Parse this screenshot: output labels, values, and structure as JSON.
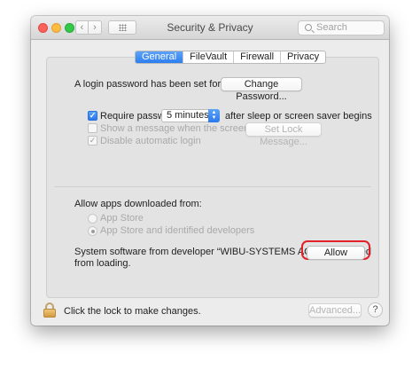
{
  "window": {
    "title": "Security & Privacy",
    "nav_back": "‹",
    "nav_forward": "›",
    "search_placeholder": "Search"
  },
  "tabs": [
    {
      "label": "General",
      "active": true
    },
    {
      "label": "FileVault",
      "active": false
    },
    {
      "label": "Firewall",
      "active": false
    },
    {
      "label": "Privacy",
      "active": false
    }
  ],
  "general": {
    "login_password_text": "A login password has been set for this user",
    "change_password_label": "Change Password...",
    "require_password_label": "Require password",
    "require_password_checked": true,
    "require_password_delay": "5 minutes",
    "require_password_suffix": "after sleep or screen saver begins",
    "show_message_label": "Show a message when the screen is locked",
    "show_message_checked": false,
    "set_lock_message_label": "Set Lock Message...",
    "disable_auto_login_label": "Disable automatic login",
    "disable_auto_login_checked": true
  },
  "downloads": {
    "heading": "Allow apps downloaded from:",
    "options": [
      {
        "label": "App Store",
        "selected": false
      },
      {
        "label": "App Store and identified developers",
        "selected": true
      }
    ]
  },
  "blocked": {
    "message_line1": "System software from developer “WIBU-SYSTEMS AG” was blocked",
    "message_line2": "from loading.",
    "allow_label": "Allow",
    "highlight_color": "#e3212a"
  },
  "footer": {
    "lock_text": "Click the lock to make changes.",
    "advanced_label": "Advanced...",
    "help_label": "?"
  },
  "colors": {
    "accent": "#2d7ef0"
  }
}
